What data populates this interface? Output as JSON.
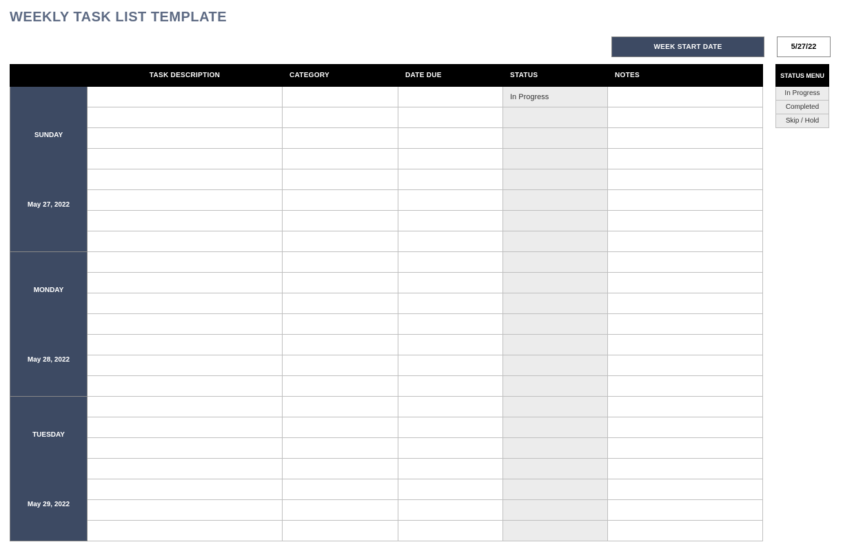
{
  "title": "WEEKLY TASK LIST TEMPLATE",
  "week_start": {
    "label": "WEEK START DATE",
    "date": "5/27/22"
  },
  "columns": {
    "day": "",
    "task": "TASK DESCRIPTION",
    "category": "CATEGORY",
    "due": "DATE DUE",
    "status": "STATUS",
    "notes": "NOTES"
  },
  "days": [
    {
      "name": "SUNDAY",
      "date": "May 27, 2022",
      "rows": 8,
      "statuses": [
        "In Progress",
        "",
        "",
        "",
        "",
        "",
        "",
        ""
      ]
    },
    {
      "name": "MONDAY",
      "date": "May 28, 2022",
      "rows": 7,
      "statuses": [
        "",
        "",
        "",
        "",
        "",
        "",
        ""
      ]
    },
    {
      "name": "TUESDAY",
      "date": "May 29, 2022",
      "rows": 7,
      "statuses": [
        "",
        "",
        "",
        "",
        "",
        "",
        ""
      ]
    }
  ],
  "status_menu": {
    "header": "STATUS MENU",
    "items": [
      "In Progress",
      "Completed",
      "Skip / Hold"
    ]
  }
}
